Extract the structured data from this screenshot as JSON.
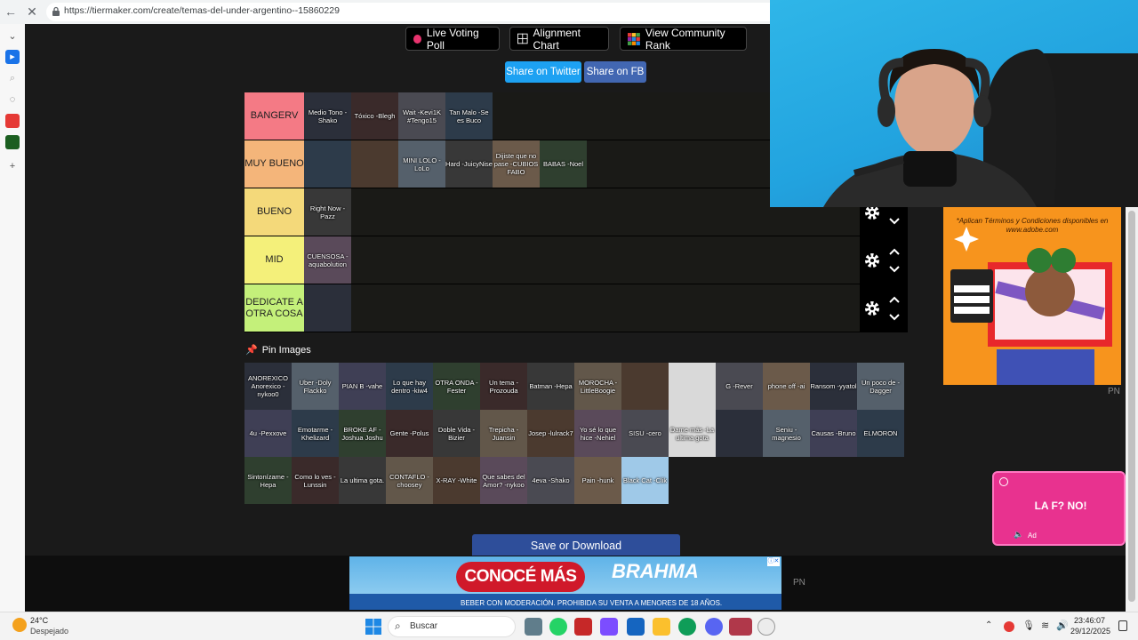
{
  "browser": {
    "url": "https://tiermaker.com/create/temas-del-under-argentino--15860229",
    "back_glyph": "←",
    "stop_glyph": "✕"
  },
  "toolbar": {
    "live_voting": "Live Voting Poll",
    "alignment": "Alignment Chart",
    "community": "View Community Rank",
    "share_twitter": "Share on Twitter",
    "share_fb": "Share on FB"
  },
  "tiers": [
    {
      "label": "BANGERV",
      "color": "#f47a85",
      "items": [
        "Medio Tono -Shako",
        "Tóxico -Blegh",
        "Wait -Kevi1K #Tengo15",
        "Tan Malo -Se es Buco"
      ]
    },
    {
      "label": "MUY BUENO",
      "color": "#f4b57a",
      "items": [
        "",
        "",
        "MINI LOLO -LoLo",
        "Hard -JuicyNise",
        "Dijiste que no pase -CUBIOS FABO",
        "BABAS -Noel"
      ]
    },
    {
      "label": "BUENO",
      "color": "#f4d97a",
      "items": [
        "Right Now -Pazz"
      ]
    },
    {
      "label": "MID",
      "color": "#f4f07a",
      "items": [
        "CUENSOSA -aquabolution"
      ]
    },
    {
      "label": "DEDICATE A OTRA COSA",
      "color": "#c4f07a",
      "items": [
        ""
      ]
    }
  ],
  "pin": {
    "title": "Pin Images",
    "items": [
      "ANOREXICO Anorexico -nykoo0",
      "Uber -Doly Flackko",
      "PIAN B -vahe",
      "Lo que hay dentro -kiw4",
      "OTRA ONDA -Fester",
      "Un tema -Prozouda",
      "Batman -Hepa",
      "MOROCHA -LittleBoogie",
      "",
      "",
      "G -Rever",
      "phone off -ai",
      "Ransom -yyatol",
      "Un poco de -Dagger",
      "4u -Pexxove",
      "Emotarme -Khelizard",
      "BROKE AF -Joshua Joshu",
      "Gente -Polus",
      "Doble Vida -Bizier",
      "Trepicha -Juansin",
      "Josep -lulrack7",
      "Yo sé lo que hice -Nehiel",
      "SISU -cero",
      "Dame más -La ultima gota",
      "",
      "Seniu -magnesio",
      "Causas -Bruno",
      "ELMORON",
      "Sintonízame -Hepa",
      "Como lo ves -Lunssin",
      "La ultima gota.",
      "CONTAFLO -choosey",
      "X-RAY -White",
      "Que sabes del Amor? -nykoo",
      "4eva -Shako",
      "Pain -hunk",
      "Black Cat -Clik"
    ]
  },
  "save_download": "Save or Download",
  "bottom_ad": {
    "cta": "CONOCÉ MÁS",
    "brand": "BRAHMA",
    "legal": "BEBER CON MODERACIÓN. PROHIBIDA SU VENTA A MENORES DE 18 AÑOS."
  },
  "side_ad": {
    "text": "*Aplican Términos y Condiciones disponibles en www.adobe.com",
    "pn": "PN"
  },
  "float_ad": {
    "text": "LA F? NO!",
    "ad_label": "Ad"
  },
  "taskbar": {
    "temp": "24°C",
    "weather": "Despejado",
    "search": "Buscar",
    "time": "23:46:07",
    "date": "29/12/2025"
  },
  "pn_bottom": "PN"
}
